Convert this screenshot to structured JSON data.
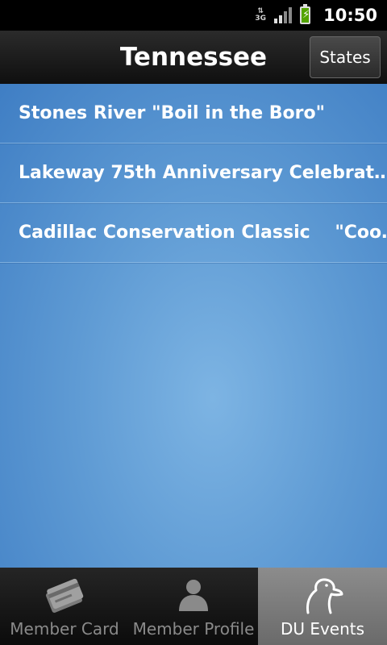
{
  "status_bar": {
    "network": "3G",
    "time": "10:50"
  },
  "header": {
    "title": "Tennessee",
    "states_button": "States"
  },
  "events": [
    {
      "label": "Stones River \"Boil in the Boro\""
    },
    {
      "label": "Lakeway 75th Anniversary Celebrat…"
    },
    {
      "label": "Cadillac Conservation Classic    \"Coo…"
    }
  ],
  "tabs": [
    {
      "label": "Member Card",
      "icon": "member-card-icon",
      "active": false
    },
    {
      "label": "Member Profile",
      "icon": "person-icon",
      "active": false
    },
    {
      "label": "DU Events",
      "icon": "duck-head-icon",
      "active": true
    }
  ],
  "colors": {
    "content_gradient_light": "#7db4e3",
    "content_gradient_dark": "#3f7ec4",
    "active_tab": "#7a7a7a",
    "battery_green": "#53a300"
  }
}
